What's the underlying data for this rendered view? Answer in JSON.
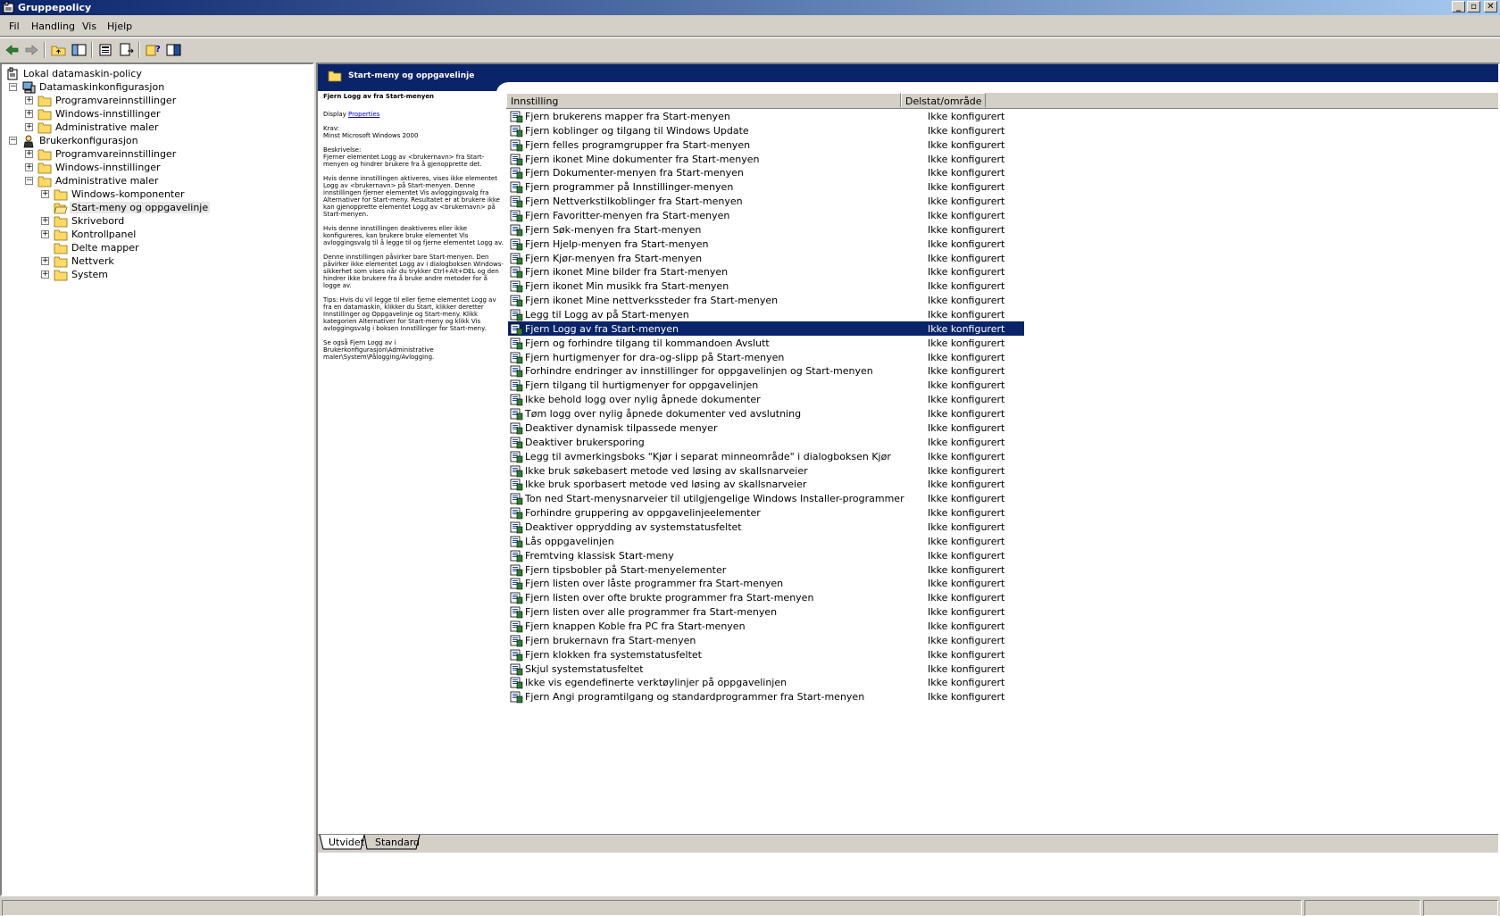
{
  "window": {
    "title": "Gruppepolicy"
  },
  "menu": [
    "Fil",
    "Handling",
    "Vis",
    "Hjelp"
  ],
  "tree": [
    {
      "label": "Lokal datamaskin-policy",
      "level": 0
    },
    {
      "label": "Datamaskinkonfigurasjon",
      "level": 1,
      "expanded": true
    },
    {
      "label": "Programvareinnstillinger",
      "level": 2
    },
    {
      "label": "Windows-innstillinger",
      "level": 2
    },
    {
      "label": "Administrative maler",
      "level": 2
    },
    {
      "label": "Brukerkonfigurasjon",
      "level": 1,
      "expanded": true
    },
    {
      "label": "Programvareinnstillinger",
      "level": 2
    },
    {
      "label": "Windows-innstillinger",
      "level": 2
    },
    {
      "label": "Administrative maler",
      "level": 2,
      "expanded": true
    },
    {
      "label": "Windows-komponenter",
      "level": 3
    },
    {
      "label": "Start-meny og oppgavelinje",
      "level": 3,
      "selected": true
    },
    {
      "label": "Skrivebord",
      "level": 3
    },
    {
      "label": "Kontrollpanel",
      "level": 3
    },
    {
      "label": "Delte mapper",
      "level": 3
    },
    {
      "label": "Nettverk",
      "level": 3
    },
    {
      "label": "System",
      "level": 3
    }
  ],
  "header": {
    "title": "Start-meny og oppgavelinje"
  },
  "description": {
    "title": "Fjern Logg av fra Start-menyen",
    "display_label": "Display",
    "properties_link": "Properties",
    "requirements": "Krav:\nMinst Microsoft Windows 2000",
    "body": [
      "Beskrivelse:\nFjerner elementet Logg av <brukernavn> fra Start-menyen og hindrer brukere fra å gjenopprette det.",
      "Hvis denne innstillingen aktiveres, vises ikke elementet Logg av <brukernavn> på Start-menyen. Denne innstillingen fjerner elementet Vis avloggingsvalg fra Alternativer for Start-meny. Resultatet er at brukere ikke kan gjenopprette elementet Logg av <brukernavn> på Start-menyen.",
      "Hvis denne innstillingen deaktiveres eller ikke konfigureres, kan brukere bruke elementet Vis avloggingsvalg til å legge til og fjerne elementet Logg av.",
      "Denne innstillingen påvirker bare Start-menyen. Den påvirker ikke elementet Logg av i dialogboksen Windows-sikkerhet som vises når du trykker Ctrl+Alt+DEL og den hindrer ikke brukere fra å bruke andre metoder for å logge av.",
      "Tips: Hvis du vil legge til eller fjerne elementet Logg av fra en datamaskin, klikker du Start, klikker deretter Innstillinger og Oppgavelinje og Start-meny. Klikk kategorien Alternativer for Start-meny og klikk Vis avloggingsvalg i boksen Innstillinger for Start-meny.",
      "Se også Fjern Logg av i Brukerkonfigurasjon\\Administrative maler\\System\\Pålogging/Avlogging."
    ]
  },
  "columns": {
    "setting": "Innstilling",
    "state": "Delstat/område"
  },
  "settings": [
    {
      "name": "Fjern brukerens mapper fra Start-menyen",
      "state": "Ikke konfigurert"
    },
    {
      "name": "Fjern koblinger og tilgang til Windows Update",
      "state": "Ikke konfigurert"
    },
    {
      "name": "Fjern felles programgrupper fra Start-menyen",
      "state": "Ikke konfigurert"
    },
    {
      "name": "Fjern ikonet Mine dokumenter fra Start-menyen",
      "state": "Ikke konfigurert"
    },
    {
      "name": "Fjern Dokumenter-menyen fra Start-menyen",
      "state": "Ikke konfigurert"
    },
    {
      "name": "Fjern programmer på Innstillinger-menyen",
      "state": "Ikke konfigurert"
    },
    {
      "name": "Fjern Nettverkstilkoblinger fra Start-menyen",
      "state": "Ikke konfigurert"
    },
    {
      "name": "Fjern Favoritter-menyen fra Start-menyen",
      "state": "Ikke konfigurert"
    },
    {
      "name": "Fjern Søk-menyen fra Start-menyen",
      "state": "Ikke konfigurert"
    },
    {
      "name": "Fjern Hjelp-menyen fra Start-menyen",
      "state": "Ikke konfigurert"
    },
    {
      "name": "Fjern Kjør-menyen fra Start-menyen",
      "state": "Ikke konfigurert"
    },
    {
      "name": "Fjern ikonet Mine bilder fra Start-menyen",
      "state": "Ikke konfigurert"
    },
    {
      "name": "Fjern ikonet Min musikk fra Start-menyen",
      "state": "Ikke konfigurert"
    },
    {
      "name": "Fjern ikonet Mine nettverkssteder fra Start-menyen",
      "state": "Ikke konfigurert"
    },
    {
      "name": "Legg til Logg av på Start-menyen",
      "state": "Ikke konfigurert"
    },
    {
      "name": "Fjern Logg av fra Start-menyen",
      "state": "Ikke konfigurert",
      "selected": true
    },
    {
      "name": "Fjern og forhindre tilgang til kommandoen Avslutt",
      "state": "Ikke konfigurert"
    },
    {
      "name": "Fjern hurtigmenyer for dra-og-slipp på Start-menyen",
      "state": "Ikke konfigurert"
    },
    {
      "name": "Forhindre endringer av innstillinger for oppgavelinjen og Start-menyen",
      "state": "Ikke konfigurert"
    },
    {
      "name": "Fjern tilgang til hurtigmenyer for oppgavelinjen",
      "state": "Ikke konfigurert"
    },
    {
      "name": "Ikke behold logg over nylig åpnede dokumenter",
      "state": "Ikke konfigurert"
    },
    {
      "name": "Tøm logg over nylig åpnede dokumenter ved avslutning",
      "state": "Ikke konfigurert"
    },
    {
      "name": "Deaktiver dynamisk tilpassede menyer",
      "state": "Ikke konfigurert"
    },
    {
      "name": "Deaktiver brukersporing",
      "state": "Ikke konfigurert"
    },
    {
      "name": "Legg til avmerkingsboks \"Kjør i separat minneområde\" i dialogboksen Kjør",
      "state": "Ikke konfigurert"
    },
    {
      "name": "Ikke bruk søkebasert metode ved løsing av skallsnarveier",
      "state": "Ikke konfigurert"
    },
    {
      "name": "Ikke bruk sporbasert metode ved løsing av skallsnarveier",
      "state": "Ikke konfigurert"
    },
    {
      "name": "Ton ned Start-menysnarveier til utilgjengelige Windows Installer-programmer",
      "state": "Ikke konfigurert"
    },
    {
      "name": "Forhindre gruppering av oppgavelinjeelementer",
      "state": "Ikke konfigurert"
    },
    {
      "name": "Deaktiver opprydding av systemstatusfeltet",
      "state": "Ikke konfigurert"
    },
    {
      "name": "Lås oppgavelinjen",
      "state": "Ikke konfigurert"
    },
    {
      "name": "Fremtving klassisk Start-meny",
      "state": "Ikke konfigurert"
    },
    {
      "name": "Fjern tipsbobler på Start-menyelementer",
      "state": "Ikke konfigurert"
    },
    {
      "name": "Fjern listen over låste programmer fra Start-menyen",
      "state": "Ikke konfigurert"
    },
    {
      "name": "Fjern listen over ofte brukte programmer fra Start-menyen",
      "state": "Ikke konfigurert"
    },
    {
      "name": "Fjern listen over alle programmer fra Start-menyen",
      "state": "Ikke konfigurert"
    },
    {
      "name": "Fjern knappen Koble fra PC fra Start-menyen",
      "state": "Ikke konfigurert"
    },
    {
      "name": "Fjern brukernavn fra Start-menyen",
      "state": "Ikke konfigurert"
    },
    {
      "name": "Fjern klokken fra systemstatusfeltet",
      "state": "Ikke konfigurert"
    },
    {
      "name": "Skjul systemstatusfeltet",
      "state": "Ikke konfigurert"
    },
    {
      "name": "Ikke vis egendefinerte verktøylinjer på oppgavelinjen",
      "state": "Ikke konfigurert"
    },
    {
      "name": "Fjern Angi programtilgang og standardprogrammer fra Start-menyen",
      "state": "Ikke konfigurert"
    }
  ],
  "tabs": [
    {
      "label": "Utvidet",
      "active": true
    },
    {
      "label": "Standard",
      "active": false
    }
  ],
  "colors": {
    "titlebar_start": "#0a246a",
    "titlebar_end": "#a6caf0",
    "selection": "#0a246a",
    "chrome": "#d4d0c8"
  },
  "icons": [
    "back-arrow-icon",
    "forward-arrow-icon",
    "up-folder-icon",
    "show-hide-tree-icon",
    "properties-icon",
    "export-list-icon",
    "help-icon",
    "console-tree-icon",
    "folder-icon",
    "policy-setting-icon",
    "computer-icon",
    "user-icon"
  ]
}
